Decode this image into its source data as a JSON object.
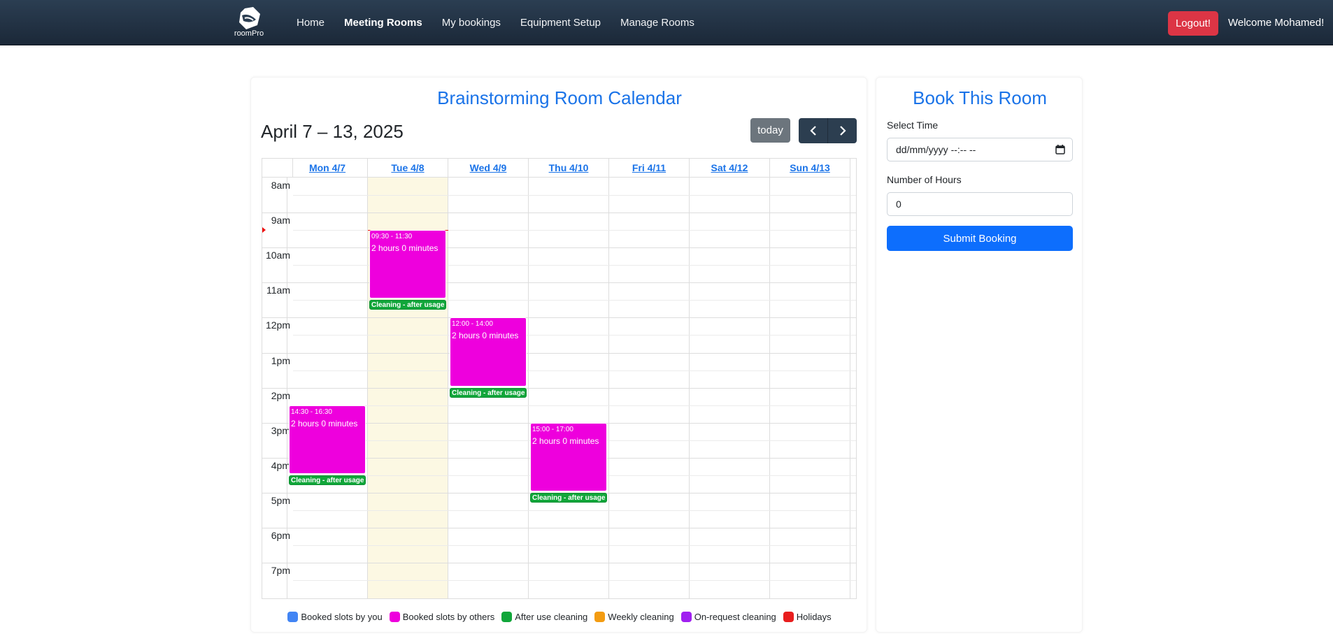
{
  "navbar": {
    "brand_text": "roomPro",
    "links": [
      "Home",
      "Meeting Rooms",
      "My bookings",
      "Equipment Setup",
      "Manage Rooms"
    ],
    "active_link": "Meeting Rooms",
    "logout_label": "Logout!",
    "welcome_text": "Welcome Mohamed!"
  },
  "calendar": {
    "title": "Brainstorming Room Calendar",
    "week_range": "April 7 – 13, 2025",
    "today_label": "today",
    "days": [
      "Mon 4/7",
      "Tue 4/8",
      "Wed 4/9",
      "Thu 4/10",
      "Fri 4/11",
      "Sat 4/12",
      "Sun 4/13"
    ],
    "today_index": 1,
    "hours": [
      "8am",
      "9am",
      "10am",
      "11am",
      "12pm",
      "1pm",
      "2pm",
      "3pm",
      "4pm",
      "5pm",
      "6pm",
      "7pm"
    ],
    "events": [
      {
        "day": 1,
        "time": "09:30 - 11:30",
        "title": "2 hours 0 minutes",
        "start": 9.5,
        "end": 11.5,
        "cleaning": "Cleaning - after usage"
      },
      {
        "day": 2,
        "time": "12:00 - 14:00",
        "title": "2 hours 0 minutes",
        "start": 12,
        "end": 14,
        "cleaning": "Cleaning - after usage"
      },
      {
        "day": 0,
        "time": "14:30 - 16:30",
        "title": "2 hours 0 minutes",
        "start": 14.5,
        "end": 16.5,
        "cleaning": "Cleaning - after usage"
      },
      {
        "day": 3,
        "time": "15:00 - 17:00",
        "title": "2 hours 0 minutes",
        "start": 15,
        "end": 17,
        "cleaning": "Cleaning - after usage"
      }
    ],
    "legend": [
      {
        "label": "Booked slots by you",
        "color": "#4285f4"
      },
      {
        "label": "Booked slots by others",
        "color": "#ee00dd"
      },
      {
        "label": "After use cleaning",
        "color": "#11a63a"
      },
      {
        "label": "Weekly cleaning",
        "color": "#f39c12"
      },
      {
        "label": "On-request cleaning",
        "color": "#a020f0"
      },
      {
        "label": "Holidays",
        "color": "#e81e1e"
      }
    ]
  },
  "booking": {
    "title": "Book This Room",
    "time_label": "Select Time",
    "time_placeholder": "dd/mm/yyyy --:-- --",
    "hours_label": "Number of Hours",
    "hours_value": "0",
    "submit_label": "Submit Booking"
  },
  "colors": {
    "accent": "#1a73e8",
    "event": "#ee00dd",
    "cleaning": "#11a63a",
    "today_bg": "#fcf8e3"
  }
}
